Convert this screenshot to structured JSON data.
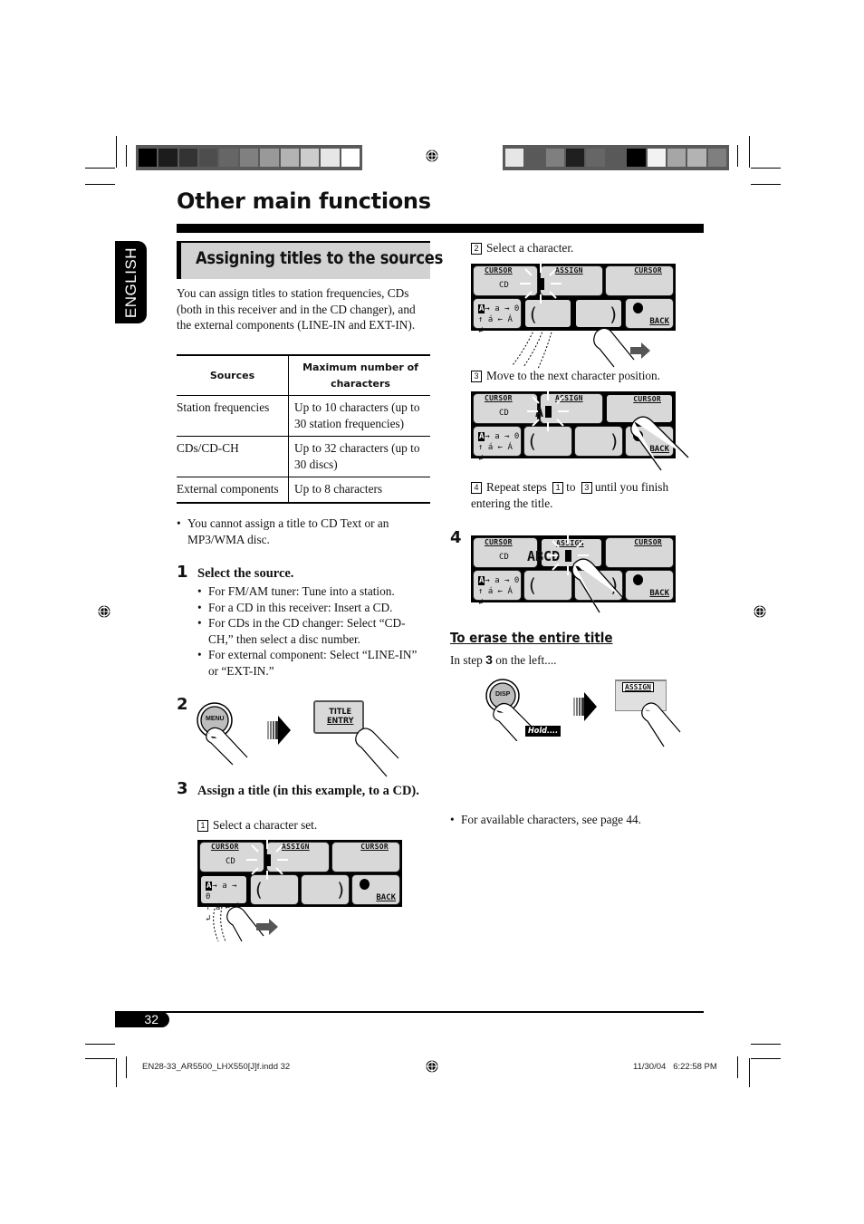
{
  "header": {
    "page_title": "Other main functions",
    "left_color_bar": [
      "#000000",
      "#1c1c1c",
      "#333333",
      "#4d4d4d",
      "#666666",
      "#808080",
      "#999999",
      "#b3b3b3",
      "#cccccc",
      "#e6e6e6",
      "#ffffff"
    ],
    "right_color_bar": [
      "#e6e6e6",
      "#595959",
      "#7f7f7f",
      "#1f1f1f",
      "#666666",
      "#595959",
      "#000000",
      "#f2f2f2",
      "#a6a6a6",
      "#b3b3b3",
      "#7f7f7f"
    ]
  },
  "language_tab": "ENGLISH",
  "section": {
    "heading": "Assigning titles to the sources",
    "intro": "You can assign titles to station frequencies, CDs (both in this receiver and in the CD changer), and the external components (LINE-IN and EXT-IN).",
    "table": {
      "headers": [
        "Sources",
        "Maximum number of characters"
      ],
      "rows": [
        [
          "Station frequencies",
          "Up to 10 characters (up to 30 station frequencies)"
        ],
        [
          "CDs/CD-CH",
          "Up to 32 characters (up to 30 discs)"
        ],
        [
          "External components",
          "Up to 8 characters"
        ]
      ]
    },
    "note": "You cannot assign a title to CD Text or an MP3/WMA disc."
  },
  "steps": [
    {
      "number": "1",
      "title": "Select the source.",
      "bullets": [
        "For FM/AM tuner: Tune into a station.",
        "For a CD in this receiver: Insert a CD.",
        "For CDs in the CD changer: Select “CD-CH,” then select a disc number.",
        "For external component: Select “LINE-IN” or “EXT-IN.”"
      ]
    },
    {
      "number": "2",
      "menu_button": "MENU",
      "title_entry_button": [
        "TITLE",
        "ENTRY"
      ]
    },
    {
      "number": "3",
      "title": "Assign a title (in this example, to a CD).",
      "substeps": [
        {
          "num": "1",
          "text": "Select a character set."
        },
        {
          "num": "2",
          "text": "Select a character."
        },
        {
          "num": "3",
          "text": "Move to the next character position."
        },
        {
          "num": "4",
          "text_before": "Repeat steps",
          "ref_a": "1",
          "text_mid": "to",
          "ref_b": "3",
          "text_after": "until you finish entering the title."
        }
      ]
    },
    {
      "number": "4"
    }
  ],
  "display": {
    "cursor_left": "CURSOR",
    "assign": "ASSIGN",
    "cursor_right": "CURSOR",
    "source": "CD",
    "charset_line1": [
      "A",
      "→ a → 0"
    ],
    "charset_line2": "↑ á ← Á ↲",
    "back": "BACK",
    "entered_step3": "A",
    "entered_step4": "ABCD"
  },
  "erase": {
    "heading": "To erase the entire title",
    "lead_before": "In step",
    "lead_num": "3",
    "lead_after": "on the left....",
    "disp_button": "DISP",
    "hold_label": "Hold....",
    "assign_button": "ASSIGN"
  },
  "note_chars": "For available characters, see page 44.",
  "footer": {
    "page_number": "32",
    "slug_left": "EN28-33_AR5500_LHX550[J]f.indd   32",
    "slug_date": "11/30/04",
    "slug_time": "6:22:58 PM"
  }
}
